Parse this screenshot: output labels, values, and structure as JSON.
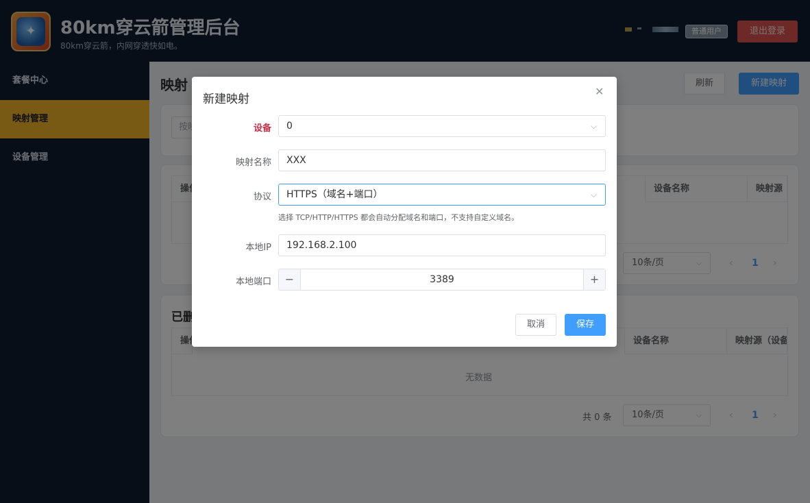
{
  "header": {
    "title": "80km穿云箭管理后台",
    "subtitle": "80km穿云箭，内网穿透快如电。",
    "user_role": "普通用户",
    "logout_label": "退出登录"
  },
  "sidebar": {
    "items": [
      {
        "label": "套餐中心"
      },
      {
        "label": "映射管理"
      },
      {
        "label": "设备管理"
      }
    ],
    "active_index": 1
  },
  "main": {
    "page_title": "映射",
    "refresh_label": "刷新",
    "new_label": "新建映射",
    "search_placeholder": "按映",
    "table1": {
      "headers": [
        "操作",
        "设备名称",
        "映射源"
      ],
      "page_size": "10条/页",
      "page": "1"
    },
    "deleted_section": {
      "title": "已删",
      "headers": [
        "操作",
        "设备名称",
        "映射源（设备"
      ],
      "empty": "无数据",
      "total": "共 0 条",
      "page_size": "10条/页",
      "page": "1"
    }
  },
  "dialog": {
    "title": "新建映射",
    "close_icon": "close-icon",
    "device_label": "设备",
    "device_value": "0",
    "name_label": "映射名称",
    "name_value": "XXX",
    "protocol_label": "协议",
    "protocol_value": "HTTPS（域名+端口）",
    "protocol_hint": "选择 TCP/HTTP/HTTPS 都会自动分配域名和端口，不支持自定义域名。",
    "ip_label": "本地IP",
    "ip_value": "192.168.2.100",
    "port_label": "本地端口",
    "port_value": "3389",
    "cancel_label": "取消",
    "save_label": "保存"
  },
  "colors": {
    "primary": "#409eff",
    "sidebar_bg": "#0f1c30",
    "sidebar_active": "#f0b52a",
    "danger": "#d9534f",
    "required_label": "#c4314b"
  }
}
